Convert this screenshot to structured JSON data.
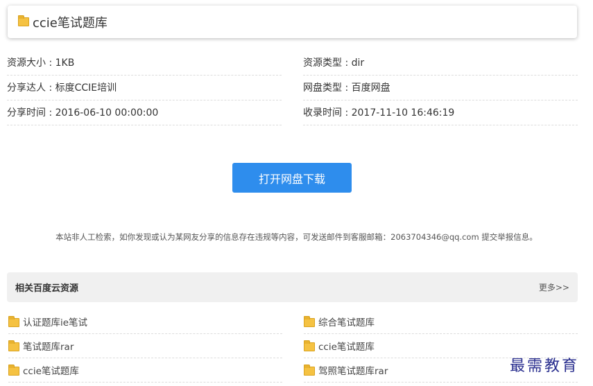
{
  "header": {
    "title": "ccie笔试题库",
    "icon": "folder-icon"
  },
  "info": [
    [
      "资源大小 : 1KB",
      "资源类型 : dir"
    ],
    [
      "分享达人 : 标度CCIE培训",
      "网盘类型 : 百度网盘"
    ],
    [
      "分享时间 : 2016-06-10 00:00:00",
      "收录时间 : 2017-11-10 16:46:19"
    ]
  ],
  "download_button": "打开网盘下载",
  "notice": "本站非人工检索，如你发现或认为某网友分享的信息存在违规等内容，可发送邮件到客服邮箱：2063704346@qq.com 提交举报信息。",
  "related": {
    "title": "相关百度云资源",
    "more": "更多>>",
    "items": [
      [
        "认证题库ie笔试",
        "综合笔试题库"
      ],
      [
        "笔试题库rar",
        "ccie笔试题库"
      ],
      [
        "ccie笔试题库",
        "驾照笔试题库rar"
      ]
    ]
  },
  "watermark": "最需教育",
  "colors": {
    "button": "#2e8ded",
    "folder": "#f5c242",
    "watermark": "#2a2f8f"
  }
}
